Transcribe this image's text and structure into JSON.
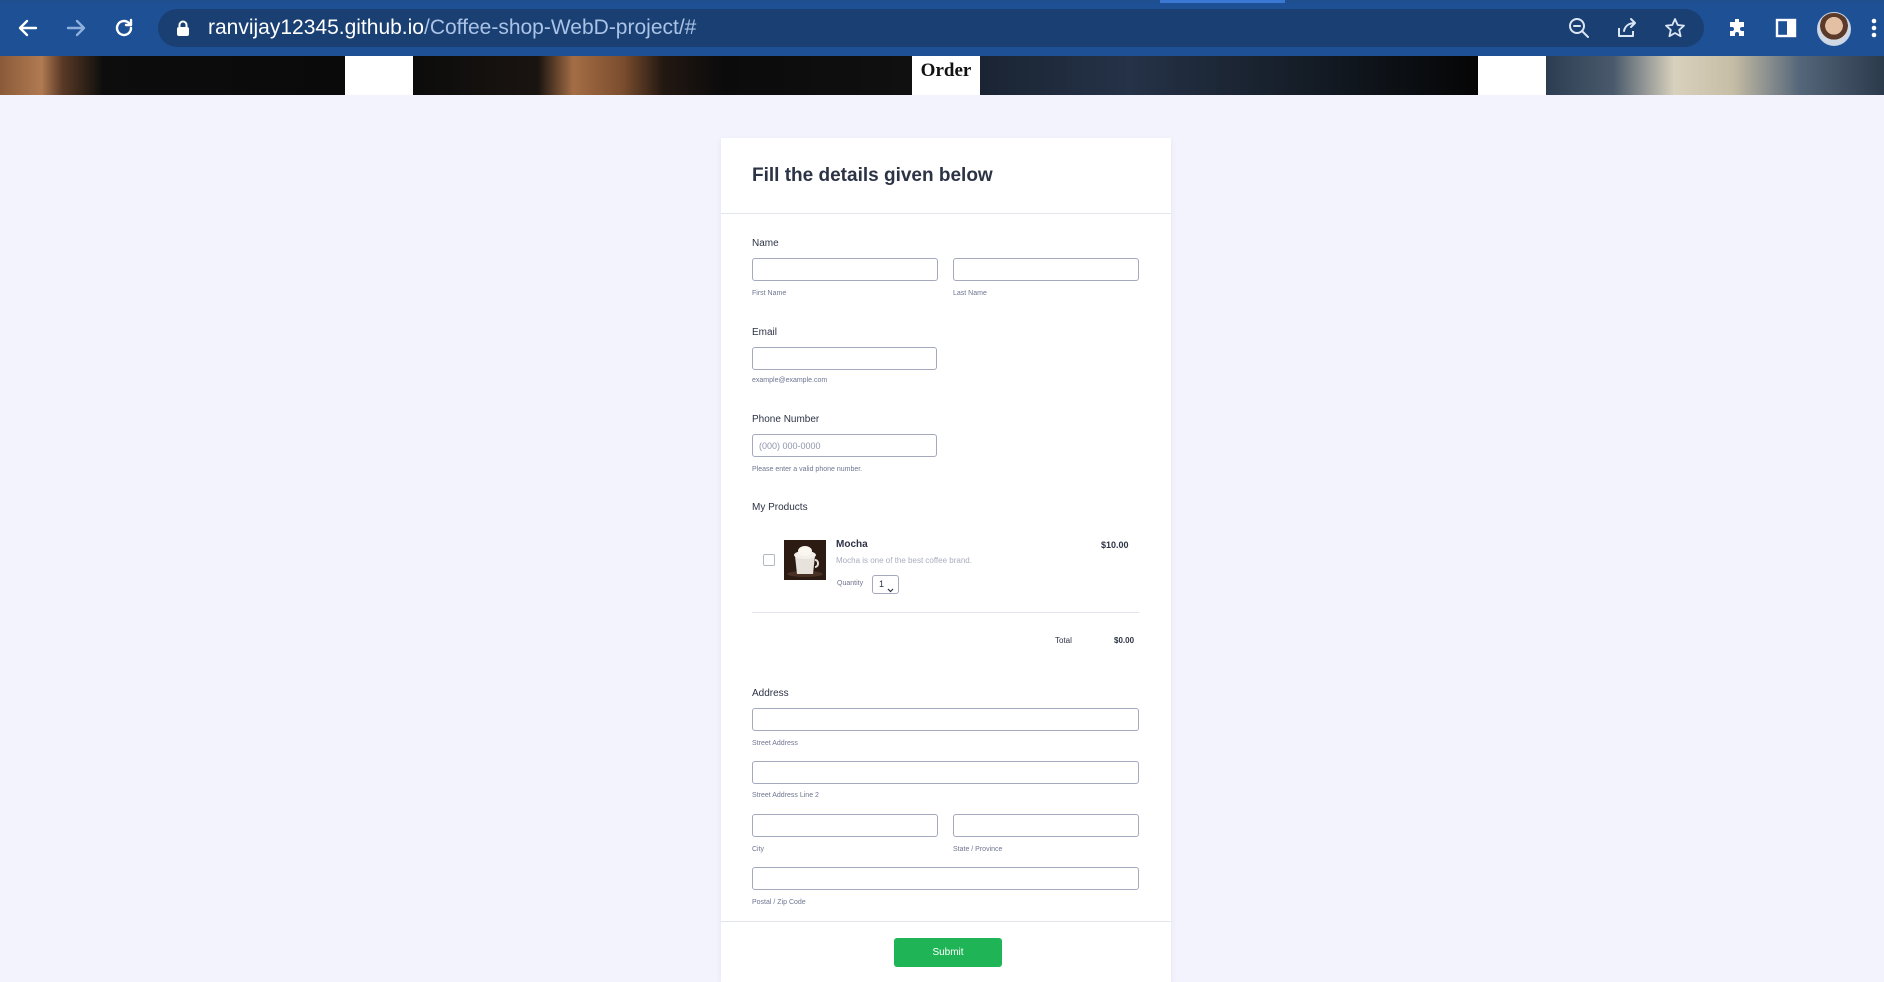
{
  "browser": {
    "url_host": "ranvijay12345.github.io",
    "url_path": "/Coffee-shop-WebD-project/#",
    "icons": [
      "back-arrow-icon",
      "forward-arrow-icon",
      "reload-icon",
      "lock-icon",
      "zoom-icon",
      "share-icon",
      "star-icon",
      "extensions-icon",
      "side-panel-icon",
      "avatar",
      "menu-icon"
    ]
  },
  "banner": {
    "order_label": "Order"
  },
  "form": {
    "title": "Fill the details given below",
    "name": {
      "label": "Name",
      "first_sub": "First Name",
      "last_sub": "Last Name"
    },
    "email": {
      "label": "Email",
      "sub": "example@example.com"
    },
    "phone": {
      "label": "Phone Number",
      "placeholder": "(000) 000-0000",
      "sub": "Please enter a valid phone number."
    },
    "products": {
      "label": "My Products",
      "items": [
        {
          "name": "Mocha",
          "description": "Mocha is one of the best coffee brand.",
          "price": "$10.00",
          "quantity_label": "Quantity",
          "quantity": "1",
          "checked": false
        }
      ],
      "total_label": "Total",
      "total_value": "$0.00"
    },
    "address": {
      "label": "Address",
      "street_sub": "Street Address",
      "street2_sub": "Street Address Line 2",
      "city_sub": "City",
      "state_sub": "State / Province",
      "postal_sub": "Postal / Zip Code"
    },
    "submit_label": "Submit"
  },
  "colors": {
    "chrome": "#1e5096",
    "omnibox": "#1a3f73",
    "page_bg": "#f3f3fe",
    "submit": "#1fb556",
    "text": "#2c3345"
  }
}
